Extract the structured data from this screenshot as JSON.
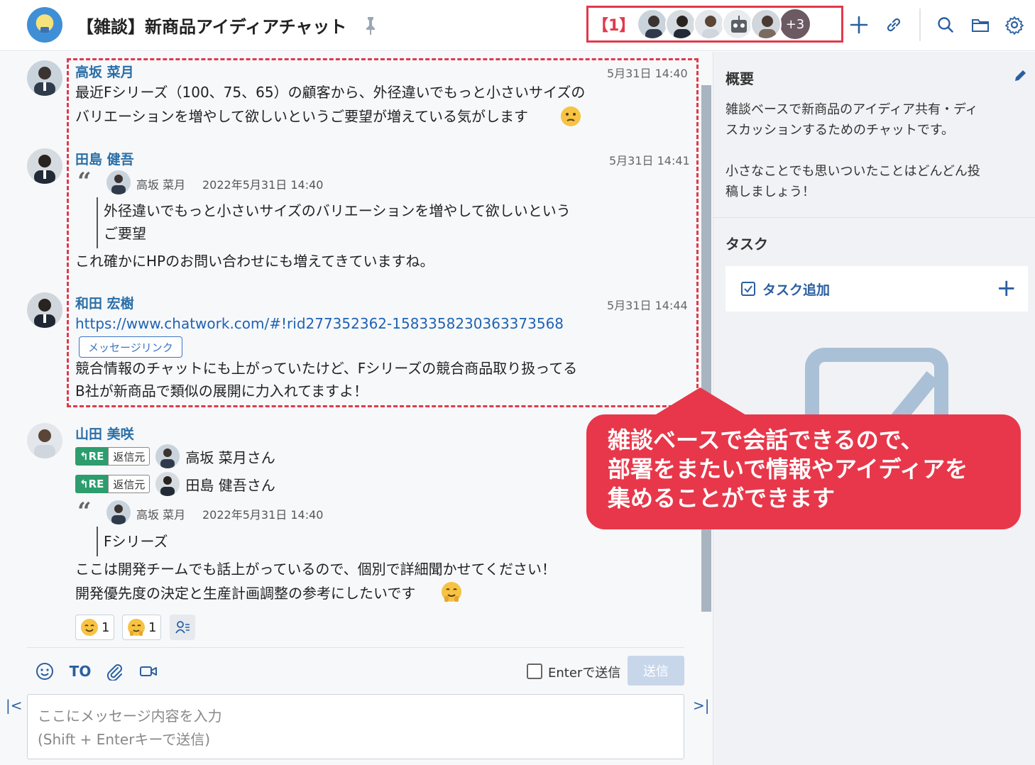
{
  "header": {
    "room_title": "【雑談】新商品アイディアチャット",
    "member_annotation": "【1】",
    "more_members": "+3"
  },
  "messages": [
    {
      "user": "高坂 菜月",
      "time": "5月31日 14:40",
      "lines": [
        "最近Fシリーズ（100、75、65）の顧客から、外径違いでもっと小さいサイズの",
        "バリエーションを増やして欲しいというご要望が増えている気がします"
      ]
    },
    {
      "user": "田島 健吾",
      "time": "5月31日 14:41",
      "quote": {
        "user": "高坂 菜月",
        "date": "2022年5月31日 14:40",
        "lines": [
          "外径違いでもっと小さいサイズのバリエーションを増やして欲しいという",
          "ご要望"
        ]
      },
      "lines": [
        "これ確かにHPのお問い合わせにも増えてきていますね。"
      ]
    },
    {
      "user": "和田 宏樹",
      "time": "5月31日 14:44",
      "link": "https://www.chatwork.com/#!rid277352362-1583358230363373568",
      "link_button": "メッセージリンク",
      "lines": [
        "競合情報のチャットにも上がっていたけど、Fシリーズの競合商品取り扱ってる",
        "B社が新商品で類似の展開に力入れてますよ！"
      ]
    },
    {
      "user": "山田 美咲",
      "replies": [
        {
          "tag": "RE",
          "source_label": "返信元",
          "name": "高坂 菜月さん"
        },
        {
          "tag": "RE",
          "source_label": "返信元",
          "name": "田島 健吾さん"
        }
      ],
      "quote": {
        "user": "高坂 菜月",
        "date": "2022年5月31日 14:40",
        "lines": [
          "Fシリーズ"
        ]
      },
      "lines": [
        "ここは開発チームでも話上がっているので、個別で詳細聞かせてください！",
        "開発優先度の決定と生産計画調整の参考にしたいです"
      ],
      "reactions": [
        {
          "emoji": "smile-emoji",
          "count": "1"
        },
        {
          "emoji": "thanks-emoji",
          "count": "1"
        }
      ]
    }
  ],
  "composer": {
    "to_label": "TO",
    "enter_send_label": "Enterで送信",
    "send_label": "送信",
    "placeholder": "ここにメッセージ内容を入力\n(Shift + Enterキーで送信)"
  },
  "right_panel": {
    "overview_title": "概要",
    "overview_lines": [
      "雑談ベースで新商品のアイディア共有・ディ",
      "スカッションするためのチャットです。",
      "",
      "小さなことでも思いついたことはどんどん投",
      "稿しましょう！"
    ],
    "task_title": "タスク",
    "task_add_label": "タスク追加"
  },
  "callout": {
    "text": "雑談ベースで会話できるので、\n部署をまたいで情報やアイディアを\n集めることができます"
  },
  "colors": {
    "accent_red": "#e03a4b",
    "link_blue": "#1e63b4",
    "name_blue": "#2a6fa7",
    "re_green": "#2d9d6e"
  }
}
